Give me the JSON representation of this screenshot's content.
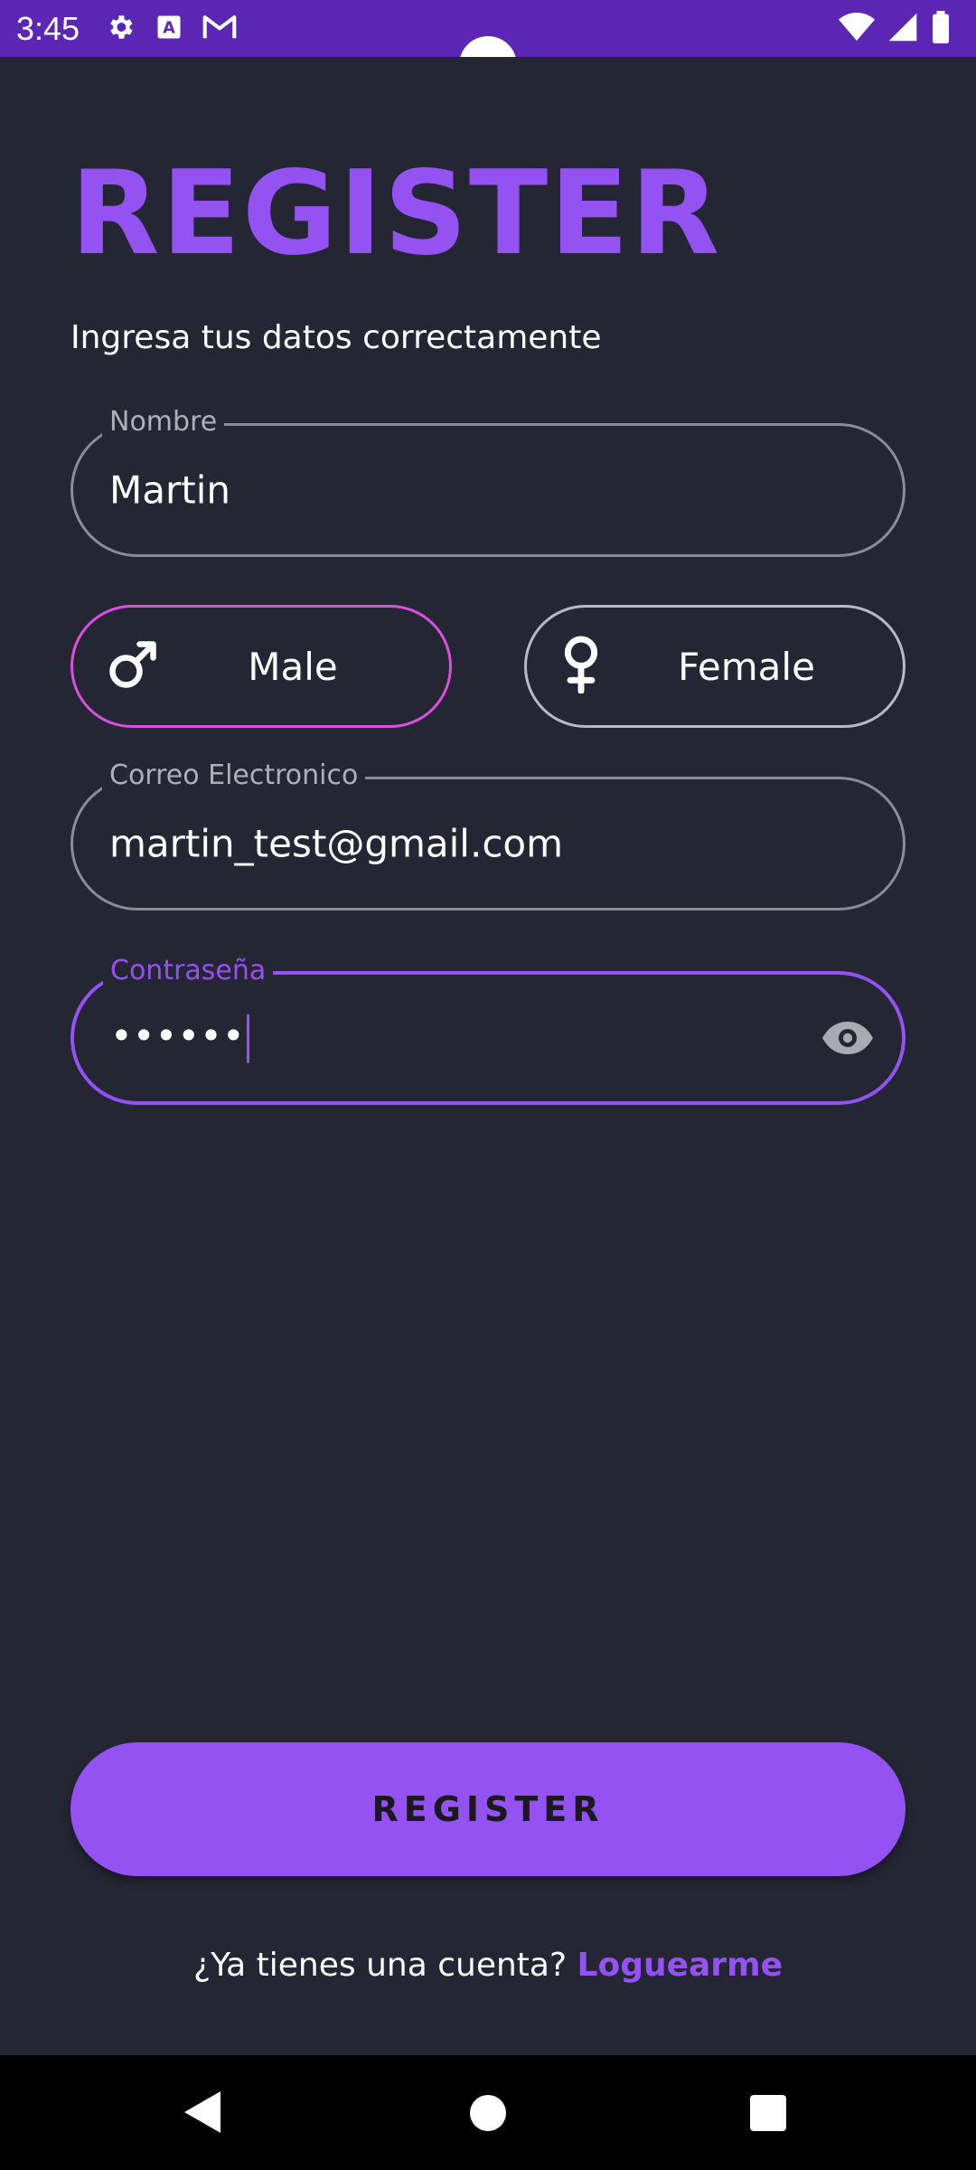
{
  "status_bar": {
    "time": "3:45",
    "icons_left": [
      "gear-icon",
      "text-a-icon",
      "gmail-icon"
    ],
    "icons_right": [
      "wifi-icon",
      "signal-icon",
      "battery-icon"
    ],
    "color": "#5b26b4"
  },
  "header": {
    "title": "REGISTER",
    "subtitle": "Ingresa tus datos correctamente"
  },
  "form": {
    "name": {
      "label": "Nombre",
      "value": "Martin"
    },
    "gender": {
      "options": [
        {
          "label": "Male",
          "icon": "male-icon",
          "selected": true
        },
        {
          "label": "Female",
          "icon": "female-icon",
          "selected": false
        }
      ]
    },
    "email": {
      "label": "Correo Electronico",
      "value": "martin_test@gmail.com"
    },
    "password": {
      "label": "Contraseña",
      "value": "••••••",
      "focused": true,
      "toggle_icon": "eye-icon"
    }
  },
  "actions": {
    "register_label": "REGISTER"
  },
  "footer": {
    "prompt": "¿Ya tienes una cuenta?",
    "link": "Loguearme"
  },
  "colors": {
    "accent": "#9452f3",
    "background": "#242633",
    "selected_border": "#d94fe0"
  }
}
